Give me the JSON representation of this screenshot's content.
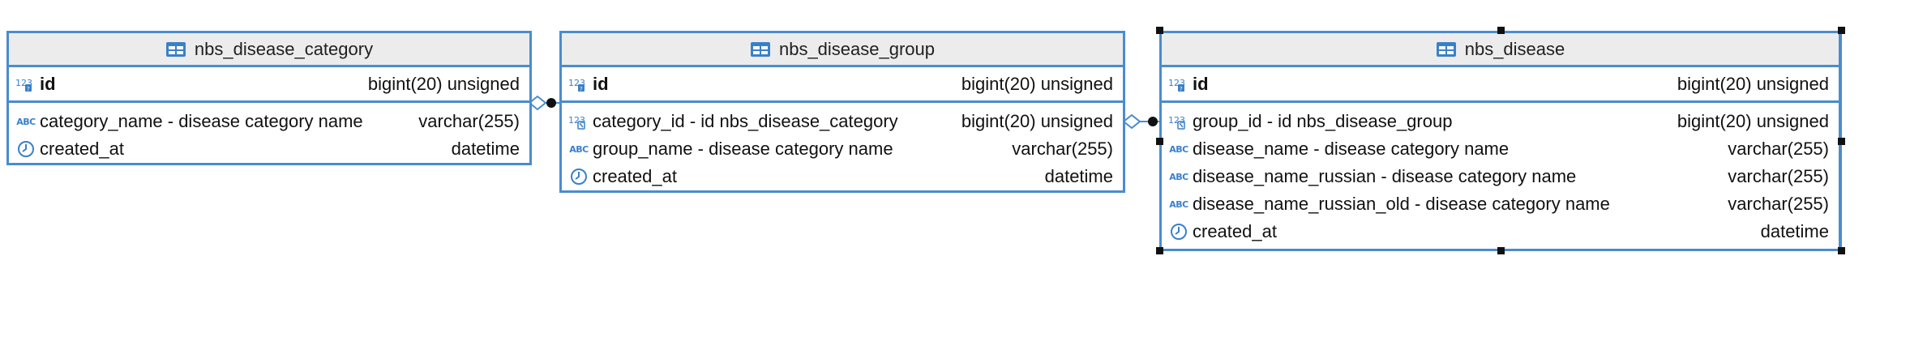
{
  "colors": {
    "border": "#4a8ccf",
    "header_bg": "#ececec",
    "icon_blue": "#3a80c9",
    "selection": "#111111"
  },
  "entities": [
    {
      "title": "nbs_disease_category",
      "pk": {
        "name": "id",
        "type": "bigint(20) unsigned",
        "icon": "numeric-key-icon"
      },
      "columns": [
        {
          "name": "category_name - disease category name",
          "type": "varchar(255)",
          "icon": "text-abc-icon"
        },
        {
          "name": "created_at",
          "type": "datetime",
          "icon": "clock-icon"
        }
      ]
    },
    {
      "title": "nbs_disease_group",
      "pk": {
        "name": "id",
        "type": "bigint(20) unsigned",
        "icon": "numeric-key-icon"
      },
      "columns": [
        {
          "name": "category_id - id nbs_disease_category",
          "type": "bigint(20) unsigned",
          "icon": "numeric-foreign-key-icon"
        },
        {
          "name": "group_name - disease category name",
          "type": "varchar(255)",
          "icon": "text-abc-icon"
        },
        {
          "name": "created_at",
          "type": "datetime",
          "icon": "clock-icon"
        }
      ]
    },
    {
      "title": "nbs_disease",
      "pk": {
        "name": "id",
        "type": "bigint(20) unsigned",
        "icon": "numeric-key-icon"
      },
      "columns": [
        {
          "name": "group_id - id nbs_disease_group",
          "type": "bigint(20) unsigned",
          "icon": "numeric-foreign-key-icon"
        },
        {
          "name": "disease_name - disease category name",
          "type": "varchar(255)",
          "icon": "text-abc-icon"
        },
        {
          "name": "disease_name_russian - disease category name",
          "type": "varchar(255)",
          "icon": "text-abc-icon"
        },
        {
          "name": "disease_name_russian_old - disease category name",
          "type": "varchar(255)",
          "icon": "text-abc-icon"
        },
        {
          "name": "created_at",
          "type": "datetime",
          "icon": "clock-icon"
        }
      ],
      "selected": true
    }
  ]
}
